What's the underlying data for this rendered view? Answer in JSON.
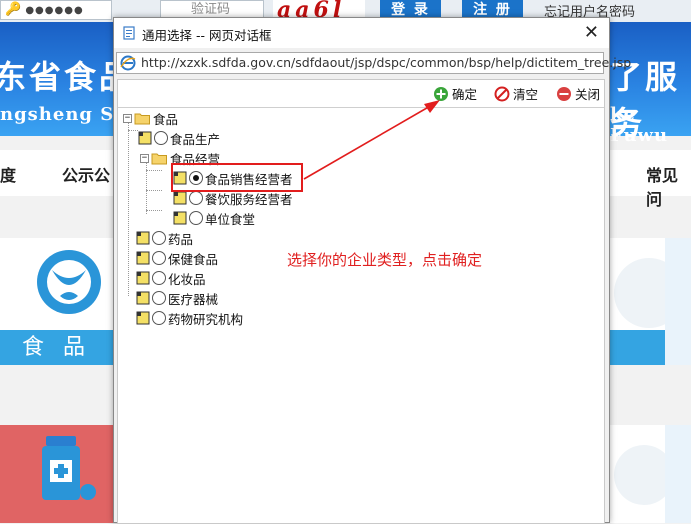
{
  "site": {
    "password_mask": "●●●●●●",
    "captcha_placeholder": "验证码",
    "captcha_image_text": "aa6l",
    "login_label": "登 录",
    "register_label": "注 册",
    "forgot_label": "忘记用户名密码",
    "banner_cn_left": "东省食品",
    "banner_cn_right": "了服务",
    "banner_en_left": "ngsheng Sh",
    "banner_en_right": "ke Fuwu",
    "nav_items": [
      "度",
      "公示公",
      "常见问"
    ],
    "card_label": "食 品"
  },
  "dialog": {
    "title": "通用选择 -- 网页对话框",
    "close": "✕",
    "url": "http://xzxk.sdfda.gov.cn/sdfdaout/jsp/dspc/common/bsp/help/dictitem_tree.jsp",
    "toolbar": {
      "confirm_label": "确定",
      "clear_label": "清空",
      "close_label": "关闭"
    },
    "tree": {
      "root_label": "食品",
      "food_production": "食品生产",
      "food_business": "食品经营",
      "food_sales": "食品销售经营者",
      "catering": "餐饮服务经营者",
      "canteen": "单位食堂",
      "drugs": "药品",
      "health_food": "保健食品",
      "cosmetics": "化妆品",
      "medical_devices": "医疗器械",
      "drug_research": "药物研究机构"
    }
  },
  "annotation": {
    "text": "选择你的企业类型，点击确定",
    "color": "#e02020"
  },
  "selected_option": "食品销售经营者"
}
